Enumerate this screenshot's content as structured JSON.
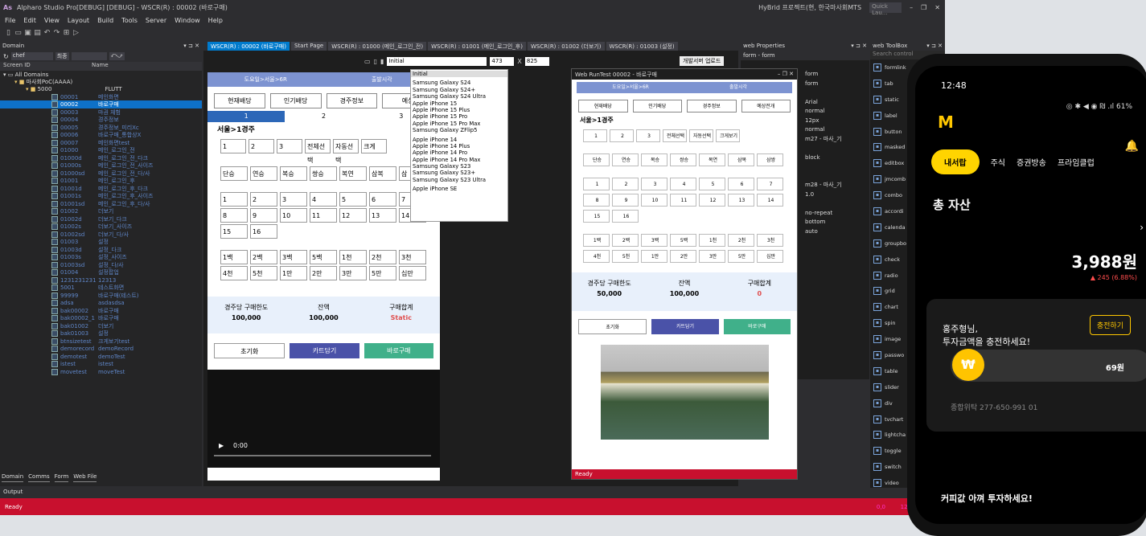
{
  "app": {
    "logo": "As",
    "title": "Alpharo Studio Pro[DEBUG] [DEBUG] - WSCR(R) : 00002 (바로구매)",
    "right_text": "HyBrid 프로젝트(현, 한국마사회MTS",
    "quick_launch": "Quick Lau..."
  },
  "menu": [
    "File",
    "Edit",
    "View",
    "Layout",
    "Build",
    "Tools",
    "Server",
    "Window",
    "Help"
  ],
  "domain_panel": {
    "title": "Domain",
    "filter_value": "chef",
    "filter_btn": "최종",
    "col_screen": "Screen ID",
    "col_name": "Name",
    "tree_root": "All Domains",
    "tree_project": "마사회PoC(AAAA)",
    "tree_folder": "5000",
    "tree_folder_name": "FLUTT",
    "rows": [
      [
        "00001",
        "메인화면"
      ],
      [
        "00002",
        "바로구매"
      ],
      [
        "00003",
        "마권 체험"
      ],
      [
        "00004",
        "경주정보"
      ],
      [
        "00005",
        "경주정보_미리Xc"
      ],
      [
        "00006",
        "바로구매_통합상X"
      ],
      [
        "00007",
        "메인화면test"
      ],
      [
        "01000",
        "메인_로그인_전"
      ],
      [
        "01000d",
        "메인_로그인_전_다크"
      ],
      [
        "01000s",
        "메인_로그인_전_사이즈"
      ],
      [
        "01000sd",
        "메인_로그인_전_다/사"
      ],
      [
        "01001",
        "메인_로그인_후"
      ],
      [
        "01001d",
        "메인_로그인_후_다크"
      ],
      [
        "01001s",
        "메인_로그인_후_사이즈"
      ],
      [
        "01001sd",
        "메인_로그인_후_다/사"
      ],
      [
        "01002",
        "더보기"
      ],
      [
        "01002d",
        "더보기_다크"
      ],
      [
        "01002s",
        "더보기_사이즈"
      ],
      [
        "01002sd",
        "더보기_다/사"
      ],
      [
        "01003",
        "설정"
      ],
      [
        "01003d",
        "설정_다크"
      ],
      [
        "01003s",
        "설정_사이즈"
      ],
      [
        "01003sd",
        "설정_다/사"
      ],
      [
        "01004",
        "설정팝업"
      ],
      [
        "1231231231",
        "12313"
      ],
      [
        "5001",
        "테스트화면"
      ],
      [
        "99999",
        "바로구매(테스트)"
      ],
      [
        "adsa",
        "asdasdsa"
      ],
      [
        "bak00002",
        "바로구매"
      ],
      [
        "bak00002_1",
        "바로구매"
      ],
      [
        "bak01002",
        "더보기"
      ],
      [
        "bak01003",
        "설정"
      ],
      [
        "btnsizetest",
        "크게보기test"
      ],
      [
        "demorecord",
        "demoRecord"
      ],
      [
        "demotest",
        "demoTest"
      ],
      [
        "istest",
        "istest"
      ],
      [
        "movetest",
        "moveTest"
      ]
    ],
    "bottom_tabs": [
      "Domain",
      "Comms",
      "Form",
      "Web File"
    ]
  },
  "output_label": "Output",
  "status": {
    "ready": "Ready",
    "zoom": "0,0",
    "size": "1208x561"
  },
  "doc_tabs": [
    "WSCR(R) : 00002 (바로구매)",
    "Start Page",
    "WSCR(R) : 01000 (메인_로그인_전)",
    "WSCR(R) : 01001 (메인_로그인_후)",
    "WSCR(R) : 01002 (더보기)",
    "WSCR(R) : 01003 (설정)"
  ],
  "editor": {
    "device": "Initial",
    "width": "473",
    "height_label": "X",
    "height": "825",
    "upload": "개발서버 업로드"
  },
  "device_list": [
    "Initial",
    "",
    "Samsung Galaxy S24",
    "Samsung Galaxy S24+",
    "Samsung Galaxy S24 Ultra",
    "Apple iPhone 15",
    "Apple iPhone 15 Plus",
    "Apple iPhone 15 Pro",
    "Apple iPhone 15 Pro Max",
    "Samsung Galaxy ZFlip5",
    "",
    "Apple iPhone 14",
    "Apple iPhone 14 Plus",
    "Apple iPhone 14 Pro",
    "Apple iPhone 14 Pro Max",
    "Samsung Galaxy S23",
    "Samsung Galaxy S23+",
    "Samsung Galaxy S23 Ultra",
    "",
    "Apple iPhone SE"
  ],
  "canvas": {
    "header": [
      "도요일>서울>6R",
      "출발시각"
    ],
    "tabs": [
      "현재배당",
      "인기배당",
      "경주정보",
      "예상"
    ],
    "steps": [
      "1",
      "2",
      "3"
    ],
    "race": "서울>1경주",
    "row1": [
      "1",
      "2",
      "3",
      "전체선택",
      "자동선택",
      "크게"
    ],
    "bettypes": [
      "단승",
      "연승",
      "복승",
      "쌍승",
      "복연",
      "삼복",
      "삼"
    ],
    "nums1": [
      "1",
      "2",
      "3",
      "4",
      "5",
      "6",
      "7"
    ],
    "nums2": [
      "8",
      "9",
      "10",
      "11",
      "12",
      "13",
      "14"
    ],
    "nums3": [
      "15",
      "16"
    ],
    "amt1": [
      "1백",
      "2백",
      "3백",
      "5백",
      "1천",
      "2천",
      "3천"
    ],
    "amt2": [
      "4천",
      "5천",
      "1만",
      "2만",
      "3만",
      "5만",
      "십만"
    ],
    "sum_labels": [
      "경주당 구매한도",
      "잔액",
      "구매합계"
    ],
    "sum_values": [
      "100,000",
      "100,000",
      "Static"
    ],
    "actions": [
      "초기화",
      "카트담기",
      "바로구매"
    ],
    "video_time": "0:00"
  },
  "props": {
    "title": "web Properties",
    "object": "form - form",
    "rows": [
      [
        "",
        "form"
      ],
      [
        "",
        "form"
      ],
      [
        "",
        ""
      ],
      [
        "",
        "Arial"
      ],
      [
        "",
        "normal"
      ],
      [
        "",
        "12px"
      ],
      [
        "",
        "normal"
      ],
      [
        "",
        "m27 - 마사_기"
      ],
      [
        "",
        ""
      ],
      [
        "",
        "block"
      ],
      [
        "",
        ""
      ],
      [
        "",
        ""
      ],
      [
        "",
        "m28 - 마사_기"
      ],
      [
        "",
        "1.0"
      ],
      [
        "",
        ""
      ],
      [
        "t",
        "no-repeat"
      ],
      [
        "on",
        "bottom"
      ],
      [
        "",
        "auto"
      ]
    ]
  },
  "toolbox": {
    "title": "web ToolBox",
    "search": "Search control",
    "items": [
      "formlink",
      "tab",
      "static",
      "label",
      "button",
      "masked",
      "editbox",
      "jmcomb",
      "combo",
      "accordi",
      "calenda",
      "groupbo",
      "check",
      "radio",
      "grid",
      "chart",
      "spin",
      "image",
      "passwo",
      "table",
      "slider",
      "div",
      "tvchart",
      "lightcha",
      "toggle",
      "switch",
      "video"
    ]
  },
  "runtest": {
    "title": "Web RunTest 00002 - 바로구매",
    "header": [
      "도요일>서울>6R",
      "출발시각"
    ],
    "tabs": [
      "현재배당",
      "인기배당",
      "경주정보",
      "예상전개"
    ],
    "race": "서울>1경주",
    "row1": [
      "1",
      "2",
      "3",
      "전체선택",
      "자동선택",
      "크게보기"
    ],
    "bettypes": [
      "단승",
      "연승",
      "복승",
      "쌍승",
      "복연",
      "삼복",
      "삼쌍"
    ],
    "nums1": [
      "1",
      "2",
      "3",
      "4",
      "5",
      "6",
      "7"
    ],
    "nums2": [
      "8",
      "9",
      "10",
      "11",
      "12",
      "13",
      "14"
    ],
    "nums3": [
      "15",
      "16"
    ],
    "amt1": [
      "1백",
      "2백",
      "3백",
      "5백",
      "1천",
      "2천",
      "3천"
    ],
    "amt2": [
      "4천",
      "5천",
      "1만",
      "2만",
      "3만",
      "5만",
      "십만"
    ],
    "sum_labels": [
      "경주당 구매한도",
      "잔액",
      "구매합계"
    ],
    "sum_values": [
      "50,000",
      "100,000",
      "0"
    ],
    "actions": [
      "초기화",
      "카트담기",
      "바로구매"
    ],
    "status": "Ready"
  },
  "phone": {
    "time": "12:48",
    "status_right": "◎ ✱ ◀ ◉ ₪ .ıl 61%",
    "logo": "M",
    "tabs": [
      "내서랍",
      "주식",
      "증권방송",
      "프라임클럽"
    ],
    "total": "총 자산",
    "amount": "3,988원",
    "change": "▲ 245 (6.88%)",
    "greeting": "홍주형님,",
    "greeting2": "투자금액을 충전하세요!",
    "charge": "충전하기",
    "coin": "₩",
    "coin_value": "69원",
    "account": "종합위탁  277-650-991 01",
    "coffee": "커피값 아껴 투자하세요!"
  }
}
